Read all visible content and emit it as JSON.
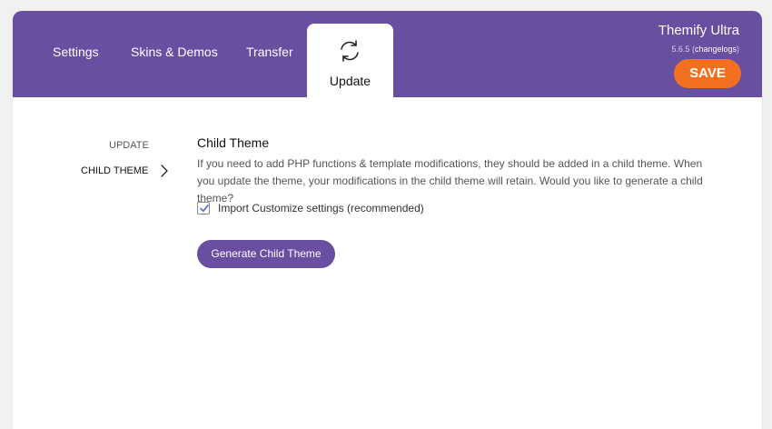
{
  "header": {
    "tabs": [
      {
        "label": "Settings"
      },
      {
        "label": "Skins & Demos"
      },
      {
        "label": "Transfer"
      },
      {
        "label": "Update",
        "active": true
      }
    ],
    "brand_name": "Themify Ultra",
    "version": "5.6.5",
    "version_paren_open": " (",
    "changelog_link": "changelogs",
    "version_paren_close": ")",
    "save_label": "SAVE"
  },
  "sidebar": {
    "items": [
      {
        "label": "UPDATE"
      },
      {
        "label": "CHILD THEME",
        "active": true
      }
    ]
  },
  "main": {
    "title": "Child Theme",
    "description": "If you need to add PHP functions & template modifications, they should be added in a child theme. When you update the theme, your modifications in the child theme will retain. Would you like to generate a child theme?",
    "checkbox_label": "Import Customize settings (recommended)",
    "checkbox_checked": true,
    "button_label": "Generate Child Theme"
  },
  "colors": {
    "header_bg": "#6a4ea0",
    "save_button": "#f2701f",
    "primary_button": "#6a4ea0",
    "page_bg": "#f1f1f1"
  },
  "icons": {
    "update_tab": "refresh-icon",
    "sidebar_active": "chevron-right-icon",
    "checkbox": "checkmark-icon"
  }
}
